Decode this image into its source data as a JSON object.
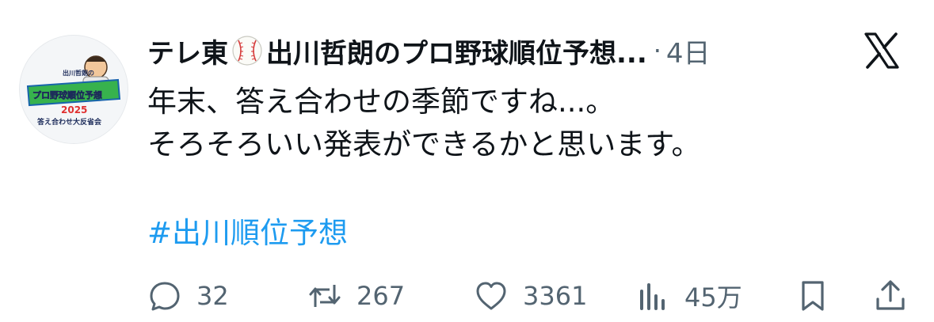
{
  "post": {
    "author_name": "テレ東",
    "author_name_rest": "出川哲朗のプロ野球順位予想...",
    "separator": "·",
    "time": "4日",
    "avatar_text": {
      "line1": "出川哲朗の",
      "line2": "プロ野球順位予想",
      "line3": "2025",
      "line4": "答え合わせ大反省会"
    },
    "body_lines": [
      "年末、答え合わせの季節ですね...。",
      "そろそろいい発表ができるかと思います。"
    ],
    "hashtag": "#出川順位予想"
  },
  "actions": {
    "replies": "32",
    "reposts": "267",
    "likes": "3361",
    "views": "45万"
  },
  "colors": {
    "text": "#0f1419",
    "secondary": "#536471",
    "link": "#1d9bf0"
  },
  "icons": [
    "baseball-emoji",
    "x-logo-icon",
    "reply-icon",
    "repost-icon",
    "like-icon",
    "views-icon",
    "bookmark-icon",
    "share-icon"
  ]
}
